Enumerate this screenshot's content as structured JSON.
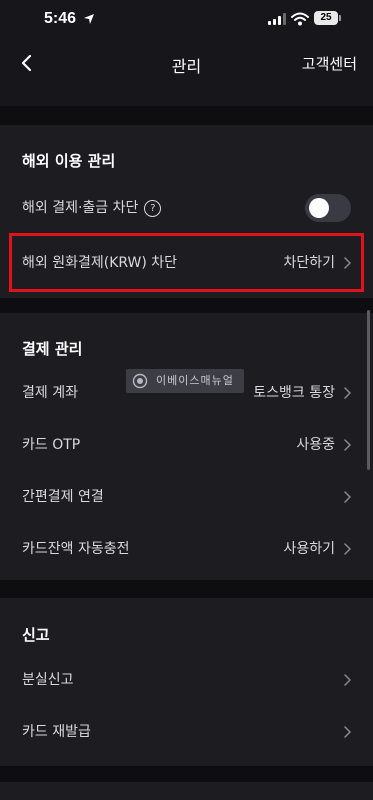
{
  "status_bar": {
    "time": "5:46",
    "battery": "25",
    "icons": [
      "location-arrow-icon",
      "signal-icon",
      "wifi-icon",
      "battery-icon"
    ]
  },
  "header": {
    "back_icon": "chevron-left-icon",
    "title": "관리",
    "help_link": "고객센터"
  },
  "sections": {
    "overseas": {
      "title": "해외 이용 관리",
      "block_payment_label": "해외 결제·출금 차단",
      "block_payment_help_icon": "question-circle-icon",
      "block_payment_toggle": "off",
      "krw_label": "해외 원화결제(KRW) 차단",
      "krw_value": "차단하기"
    },
    "payment": {
      "title": "결제 관리",
      "rows": [
        {
          "label": "결제 계좌",
          "value": "토스뱅크 통장"
        },
        {
          "label": "카드 OTP",
          "value": "사용중"
        },
        {
          "label": "간편결제 연결",
          "value": ""
        },
        {
          "label": "카드잔액 자동충전",
          "value": "사용하기"
        }
      ]
    },
    "report": {
      "title": "신고",
      "rows": [
        {
          "label": "분실신고"
        },
        {
          "label": "카드 재발급"
        }
      ]
    }
  },
  "watermark": {
    "text": "이베이스매뉴얼"
  },
  "colors": {
    "background": "#0e0e10",
    "card": "#1c1c21",
    "highlight_border": "#e0121b",
    "toggle_off": "#3a3a42"
  }
}
